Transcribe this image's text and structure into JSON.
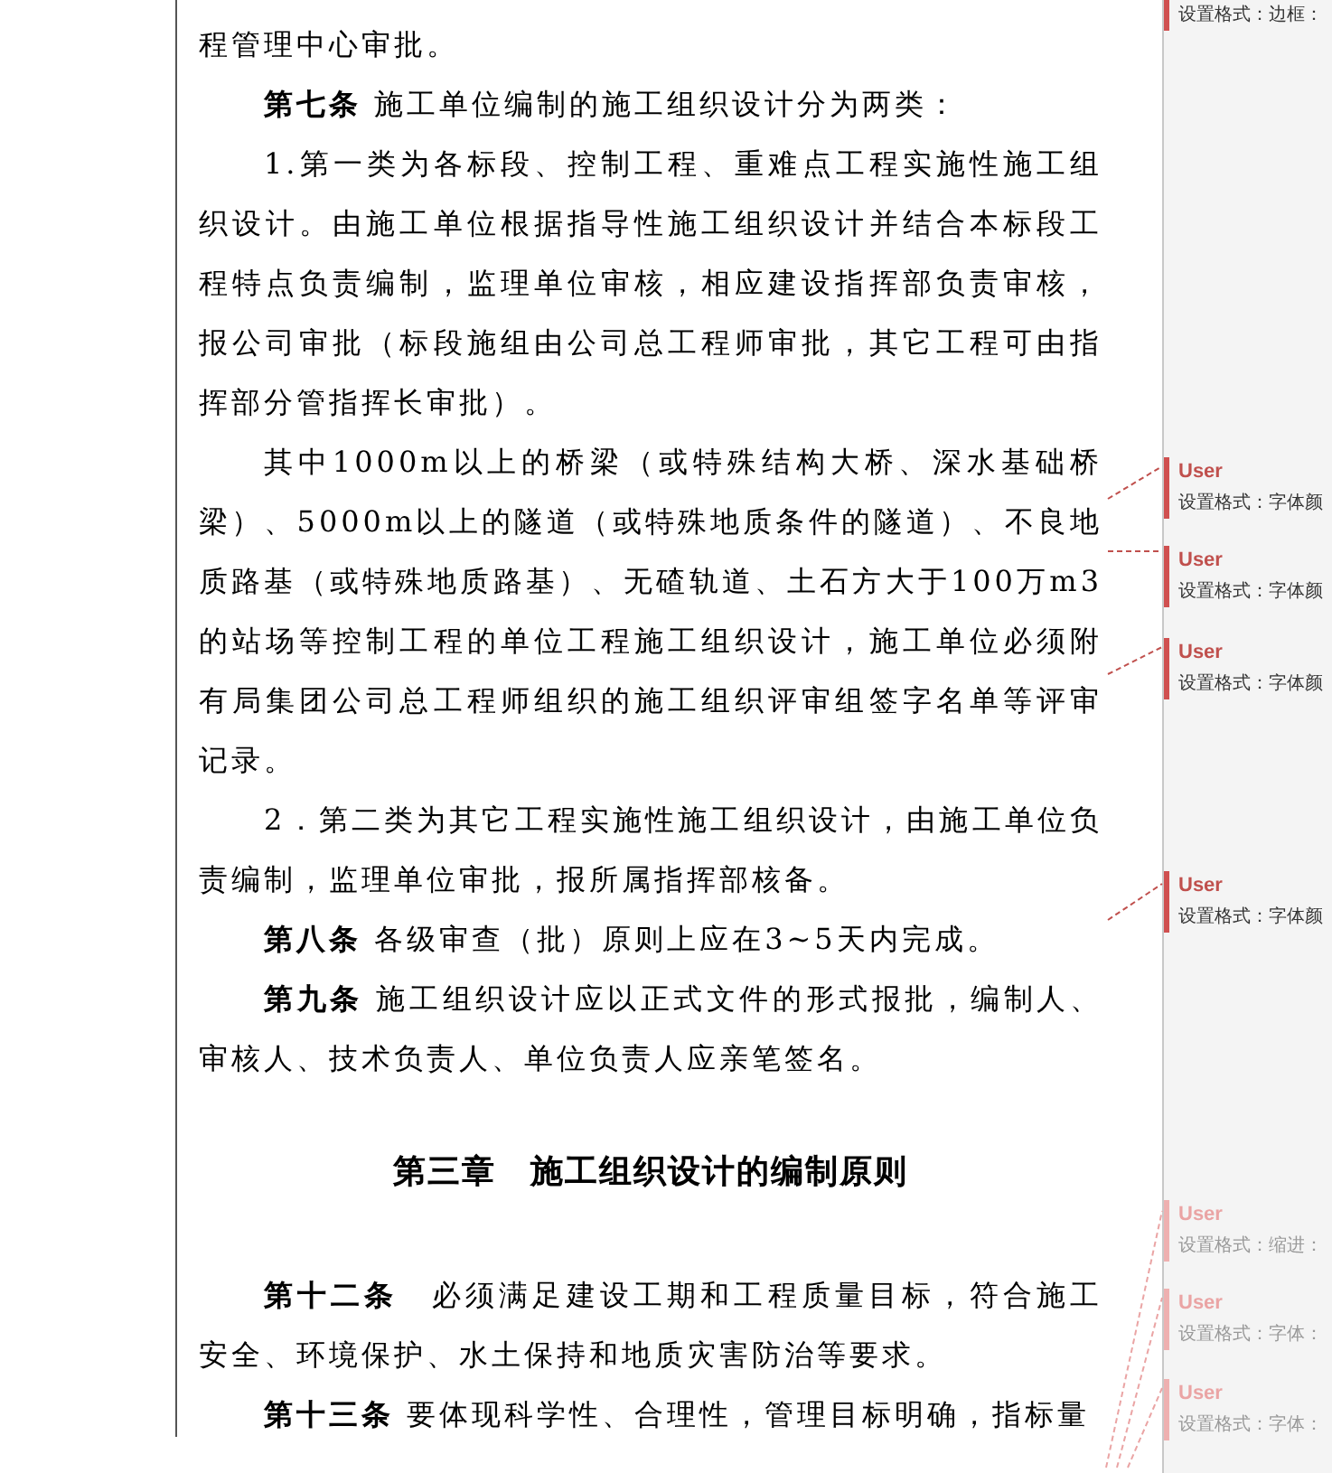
{
  "document": {
    "paragraphs": [
      {
        "kind": "body",
        "indent": false,
        "text": "程管理中心审批。"
      },
      {
        "kind": "body",
        "indent": true,
        "text": "**第七条** 施工单位编制的施工组织设计分为两类："
      },
      {
        "kind": "body",
        "indent": true,
        "text": "1.第一类为各标段、控制工程、重难点工程实施性施工组织设计。由施工单位根据指导性施工组织设计并结合本标段工程特点负责编制，监理单位审核，相应建设指挥部负责审核，报公司审批（标段施组由公司总工程师审批，其它工程可由指挥部分管指挥长审批）。"
      },
      {
        "kind": "body",
        "indent": true,
        "text": "其中1000m以上的桥梁（或特殊结构大桥、深水基础桥梁）、5000m以上的隧道（或特殊地质条件的隧道）、不良地质路基（或特殊地质路基）、无碴轨道、土石方大于100万m3的站场等控制工程的单位工程施工组织设计，施工单位必须附有局集团公司总工程师组织的施工组织评审组签字名单等评审记录。"
      },
      {
        "kind": "body",
        "indent": true,
        "text": "2．第二类为其它工程实施性施工组织设计，由施工单位负责编制，监理单位审批，报所属指挥部核备。"
      },
      {
        "kind": "body",
        "indent": true,
        "text": "**第八条** 各级审查（批）原则上应在3~5天内完成。"
      },
      {
        "kind": "body",
        "indent": true,
        "text": "**第九条** 施工组织设计应以正式文件的形式报批，编制人、审核人、技术负责人、单位负责人应亲笔签名。"
      },
      {
        "kind": "heading",
        "text": "第三章　施工组织设计的编制原则"
      },
      {
        "kind": "body",
        "indent": true,
        "text": "**第十二条**　必须满足建设工期和工程质量目标，符合施工安全、环境保护、水土保持和地质灾害防治等要求。"
      },
      {
        "kind": "body",
        "indent": true,
        "text": "**第十三条** 要体现科学性、合理性，管理目标明确，指标量"
      }
    ],
    "comments": [
      {
        "text": "设置格式：边框：",
        "active": true
      },
      {
        "author": "User",
        "text": "设置格式：字体颜",
        "active": true
      },
      {
        "author": "User",
        "text": "设置格式：字体颜",
        "active": true
      },
      {
        "author": "User",
        "text": "设置格式：字体颜",
        "active": true
      },
      {
        "author": "User",
        "text": "设置格式：字体颜",
        "active": true
      },
      {
        "author": "User",
        "text": "设置格式：缩进：",
        "active": false
      },
      {
        "author": "User",
        "text": "设置格式：字体：",
        "active": false
      },
      {
        "author": "User",
        "text": "设置格式：字体：",
        "active": false
      }
    ]
  }
}
